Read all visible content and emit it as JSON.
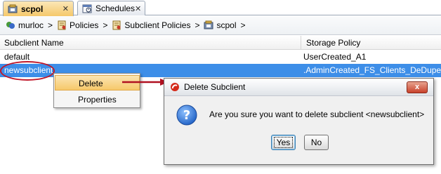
{
  "tabs": [
    {
      "label": "scpol",
      "close": "✕",
      "active": true
    },
    {
      "label": "Schedules",
      "close": "✕",
      "active": false
    }
  ],
  "breadcrumb": {
    "items": [
      "murloc",
      "Policies",
      "Subclient Policies",
      "scpol"
    ],
    "separator": ">"
  },
  "table": {
    "columns": [
      "Subclient Name",
      "Storage Policy"
    ],
    "rows": [
      {
        "name": "default",
        "policy": "UserCreated_A1"
      },
      {
        "name": "newsubclient",
        "policy": ".AdminCreated_FS_Clients_DeDupe"
      }
    ]
  },
  "context_menu": {
    "items": [
      "Delete",
      "Properties"
    ]
  },
  "dialog": {
    "title": "Delete Subclient",
    "message": "Are you sure you want to delete subclient <newsubclient>",
    "yes_label": "Yes",
    "no_label": "No",
    "close_label": "x"
  },
  "colors": {
    "selection": "#3d8ee8",
    "annotation": "#c0182a",
    "menu_highlight": "#f6c86a"
  }
}
